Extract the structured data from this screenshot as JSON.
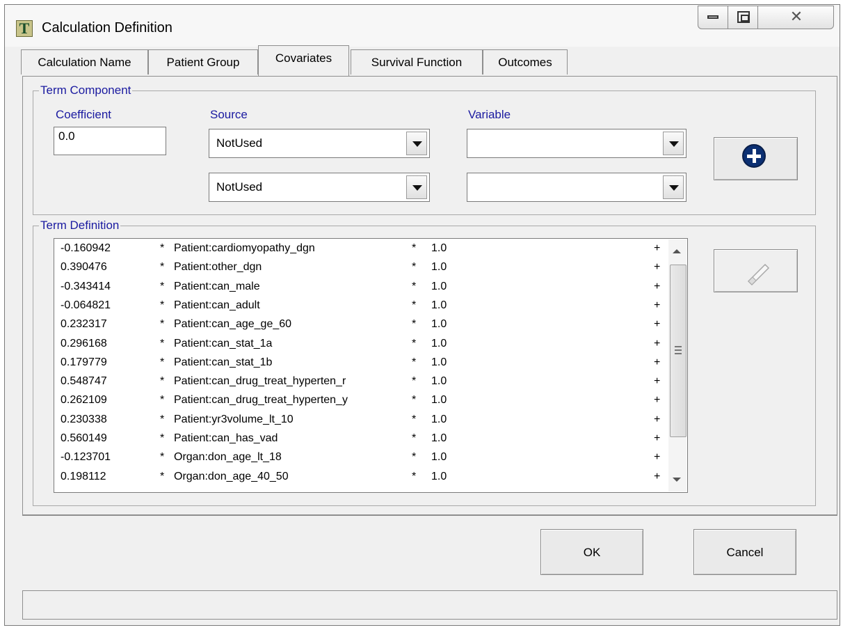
{
  "window": {
    "title": "Calculation Definition"
  },
  "tabs": [
    {
      "label": "Calculation Name"
    },
    {
      "label": "Patient Group"
    },
    {
      "label": "Covariates"
    },
    {
      "label": "Survival Function"
    },
    {
      "label": "Outcomes"
    }
  ],
  "term_component": {
    "legend": "Term Component",
    "coefficient_label": "Coefficient",
    "coefficient_value": "0.0",
    "source_label": "Source",
    "variable_label": "Variable",
    "source1": "NotUsed",
    "source2": "NotUsed",
    "variable1": "",
    "variable2": ""
  },
  "term_definition": {
    "legend": "Term Definition",
    "rows": [
      {
        "coef": "-0.160942",
        "op1": "*",
        "term": "Patient:cardiomyopathy_dgn",
        "op2": "*",
        "value": "1.0",
        "plus": "+"
      },
      {
        "coef": "0.390476",
        "op1": "*",
        "term": "Patient:other_dgn",
        "op2": "*",
        "value": "1.0",
        "plus": "+"
      },
      {
        "coef": "-0.343414",
        "op1": "*",
        "term": "Patient:can_male",
        "op2": "*",
        "value": "1.0",
        "plus": "+"
      },
      {
        "coef": "-0.064821",
        "op1": "*",
        "term": "Patient:can_adult",
        "op2": "*",
        "value": "1.0",
        "plus": "+"
      },
      {
        "coef": "0.232317",
        "op1": "*",
        "term": "Patient:can_age_ge_60",
        "op2": "*",
        "value": "1.0",
        "plus": "+"
      },
      {
        "coef": "0.296168",
        "op1": "*",
        "term": "Patient:can_stat_1a",
        "op2": "*",
        "value": "1.0",
        "plus": "+"
      },
      {
        "coef": "0.179779",
        "op1": "*",
        "term": "Patient:can_stat_1b",
        "op2": "*",
        "value": "1.0",
        "plus": "+"
      },
      {
        "coef": "0.548747",
        "op1": "*",
        "term": "Patient:can_drug_treat_hyperten_r",
        "op2": "*",
        "value": "1.0",
        "plus": "+"
      },
      {
        "coef": "0.262109",
        "op1": "*",
        "term": "Patient:can_drug_treat_hyperten_y",
        "op2": "*",
        "value": "1.0",
        "plus": "+"
      },
      {
        "coef": "0.230338",
        "op1": "*",
        "term": "Patient:yr3volume_lt_10",
        "op2": "*",
        "value": "1.0",
        "plus": "+"
      },
      {
        "coef": "0.560149",
        "op1": "*",
        "term": "Patient:can_has_vad",
        "op2": "*",
        "value": "1.0",
        "plus": "+"
      },
      {
        "coef": "-0.123701",
        "op1": "*",
        "term": "Organ:don_age_lt_18",
        "op2": "*",
        "value": "1.0",
        "plus": "+"
      },
      {
        "coef": "0.198112",
        "op1": "*",
        "term": "Organ:don_age_40_50",
        "op2": "*",
        "value": "1.0",
        "plus": "+"
      }
    ]
  },
  "buttons": {
    "ok": "OK",
    "cancel": "Cancel"
  },
  "icons": {
    "add": "plus-circle-icon",
    "remove": "eraser-icon",
    "app": "app-icon"
  }
}
